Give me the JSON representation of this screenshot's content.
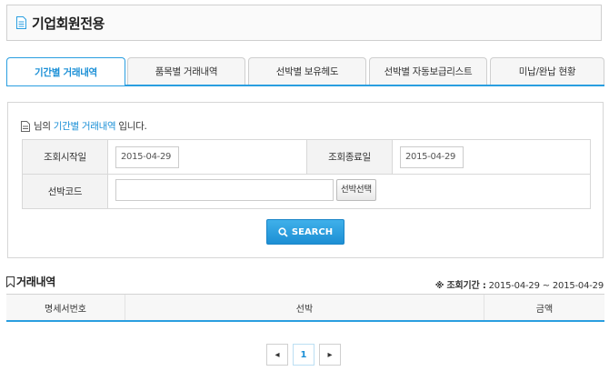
{
  "header": {
    "title": "기업회원전용"
  },
  "tabs": [
    {
      "label": "기간별 거래내역",
      "active": true
    },
    {
      "label": "품목별 거래내역",
      "active": false
    },
    {
      "label": "선박별 보유헤도",
      "active": false
    },
    {
      "label": "선박별 자동보급리스트",
      "active": false
    },
    {
      "label": "미납/완납 현황",
      "active": false
    }
  ],
  "description": {
    "prefix": "님의",
    "highlight": "기간별 거래내역",
    "suffix": "입니다."
  },
  "search_form": {
    "start_label": "조회시작일",
    "start_value": "2015-04-29",
    "end_label": "조회종료일",
    "end_value": "2015-04-29",
    "ship_code_label": "선박코드",
    "ship_code_value": "",
    "ship_select_button": "선박선택",
    "search_button": "SEARCH"
  },
  "transactions": {
    "title": "거래내역",
    "period_label": "※ 조회기간 :",
    "period_value": "2015-04-29 ~ 2015-04-29",
    "columns": [
      "명세서번호",
      "선박",
      "금액"
    ],
    "rows": []
  },
  "pagination": {
    "prev": "◂",
    "current_page": "1",
    "next": "▸"
  },
  "colors": {
    "accent": "#2a9ee0",
    "highlight_text": "#1a8fd6"
  }
}
